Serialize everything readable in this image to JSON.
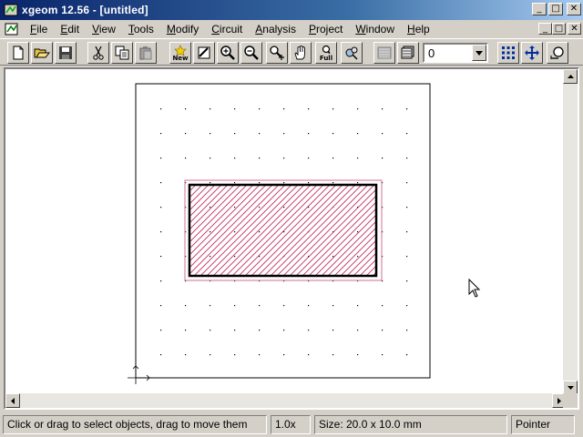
{
  "window": {
    "title": "xgeom 12.56 - [untitled]",
    "controls": {
      "minimize": "_",
      "maximize": "□",
      "close": "✕"
    }
  },
  "menu": {
    "items": [
      {
        "label": "File",
        "mnemonic": "F",
        "rest": "ile"
      },
      {
        "label": "Edit",
        "mnemonic": "E",
        "rest": "dit"
      },
      {
        "label": "View",
        "mnemonic": "V",
        "rest": "iew"
      },
      {
        "label": "Tools",
        "mnemonic": "T",
        "rest": "ools"
      },
      {
        "label": "Modify",
        "mnemonic": "M",
        "rest": "odify"
      },
      {
        "label": "Circuit",
        "mnemonic": "C",
        "rest": "ircuit"
      },
      {
        "label": "Analysis",
        "mnemonic": "A",
        "rest": "nalysis"
      },
      {
        "label": "Project",
        "mnemonic": "P",
        "rest": "roject"
      },
      {
        "label": "Window",
        "mnemonic": "W",
        "rest": "indow"
      },
      {
        "label": "Help",
        "mnemonic": "H",
        "rest": "elp"
      }
    ]
  },
  "toolbar": {
    "new_label": "New",
    "full_label": "Full",
    "layer_value": "0"
  },
  "colors": {
    "hatch": "#c03060",
    "selection": "#d07090",
    "title_start": "#0a246a",
    "title_end": "#a6caf0"
  },
  "statusbar": {
    "hint": "Click or drag to select objects, drag to move them",
    "zoom": "1.0x",
    "size": "Size: 20.0 x 10.0 mm",
    "mode": "Pointer"
  }
}
